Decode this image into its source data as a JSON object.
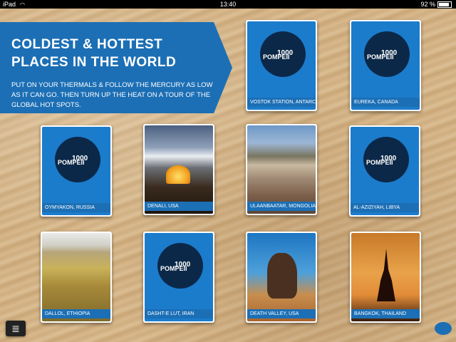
{
  "status_bar": {
    "device": "iPad",
    "time": "13:40",
    "battery": "92 %"
  },
  "banner": {
    "title": "COLDEST & HOTTEST PLACES IN THE WORLD",
    "description": "PUT ON YOUR THERMALS & FOLLOW THE MERCURY AS LOW AS IT CAN GO. THEN TURN UP THE HEAT ON A TOUR OF THE GLOBAL HOT SPOTS."
  },
  "cover_art": {
    "number": "1000",
    "word": "POMPEII"
  },
  "cards": [
    {
      "label": "VOSTOK STATION, ANTARCTICA"
    },
    {
      "label": "EUREKA, CANADA"
    },
    {
      "label": "OYMYAKON, RUSSIA"
    },
    {
      "label": "DENALI, USA"
    },
    {
      "label": "ULAANBAATAR, MONGOLIA"
    },
    {
      "label": "AL-AZIZIYAH, LIBYA"
    },
    {
      "label": "DALLOL, ETHIOPIA"
    },
    {
      "label": "DASHT-E LUT, IRAN"
    },
    {
      "label": "DEATH VALLEY, USA"
    },
    {
      "label": "BANGKOK, THAILAND"
    }
  ],
  "icons": {
    "menu": "layers-icon",
    "brand": "lonely-planet-logo"
  }
}
